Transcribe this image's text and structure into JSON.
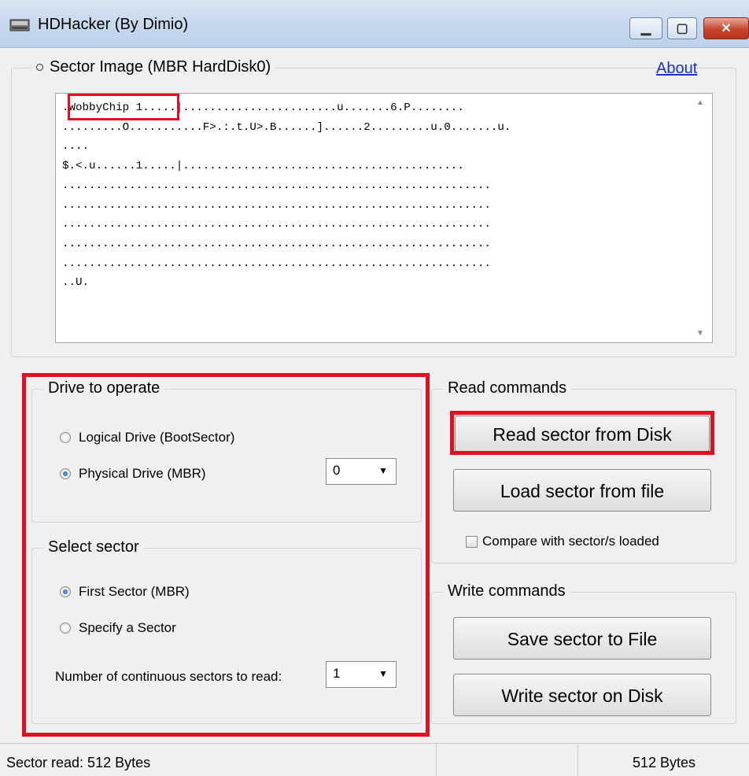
{
  "window": {
    "title": "HDHacker (By Dimio)",
    "controls": {
      "minimize": "▁",
      "maximize": "▢",
      "close": "✕"
    }
  },
  "sector_image": {
    "legend": "Sector Image (MBR HardDisk0)",
    "about_label": "About",
    "content": ".WobbyChip 1.....|.......................u.......6.P........\n.........O...........F>.:.t.U>.B......]......2.........u.0.......u.\n....\n$.<.u......1.....|..........................................\n................................................................\n................................................................\n................................................................\n................................................................\n................................................................\n..U."
  },
  "drive_group": {
    "legend": "Drive to operate",
    "logical_label": "Logical Drive (BootSector)",
    "physical_label": "Physical Drive (MBR)",
    "drive_select_value": "0"
  },
  "select_group": {
    "legend": "Select sector",
    "first_label": "First Sector (MBR)",
    "specify_label": "Specify a Sector",
    "count_label": "Number of continuous sectors to read:",
    "count_value": "1"
  },
  "read_group": {
    "legend": "Read commands",
    "read_disk_label": "Read sector from Disk",
    "load_file_label": "Load sector from file",
    "compare_label": "Compare with sector/s loaded"
  },
  "write_group": {
    "legend": "Write commands",
    "save_file_label": "Save sector to File",
    "write_disk_label": "Write sector on Disk"
  },
  "status": {
    "left": "Sector read: 512 Bytes",
    "middle": "",
    "right": "512 Bytes"
  },
  "colors": {
    "highlight": "#e01020",
    "link": "#1a33cc"
  }
}
